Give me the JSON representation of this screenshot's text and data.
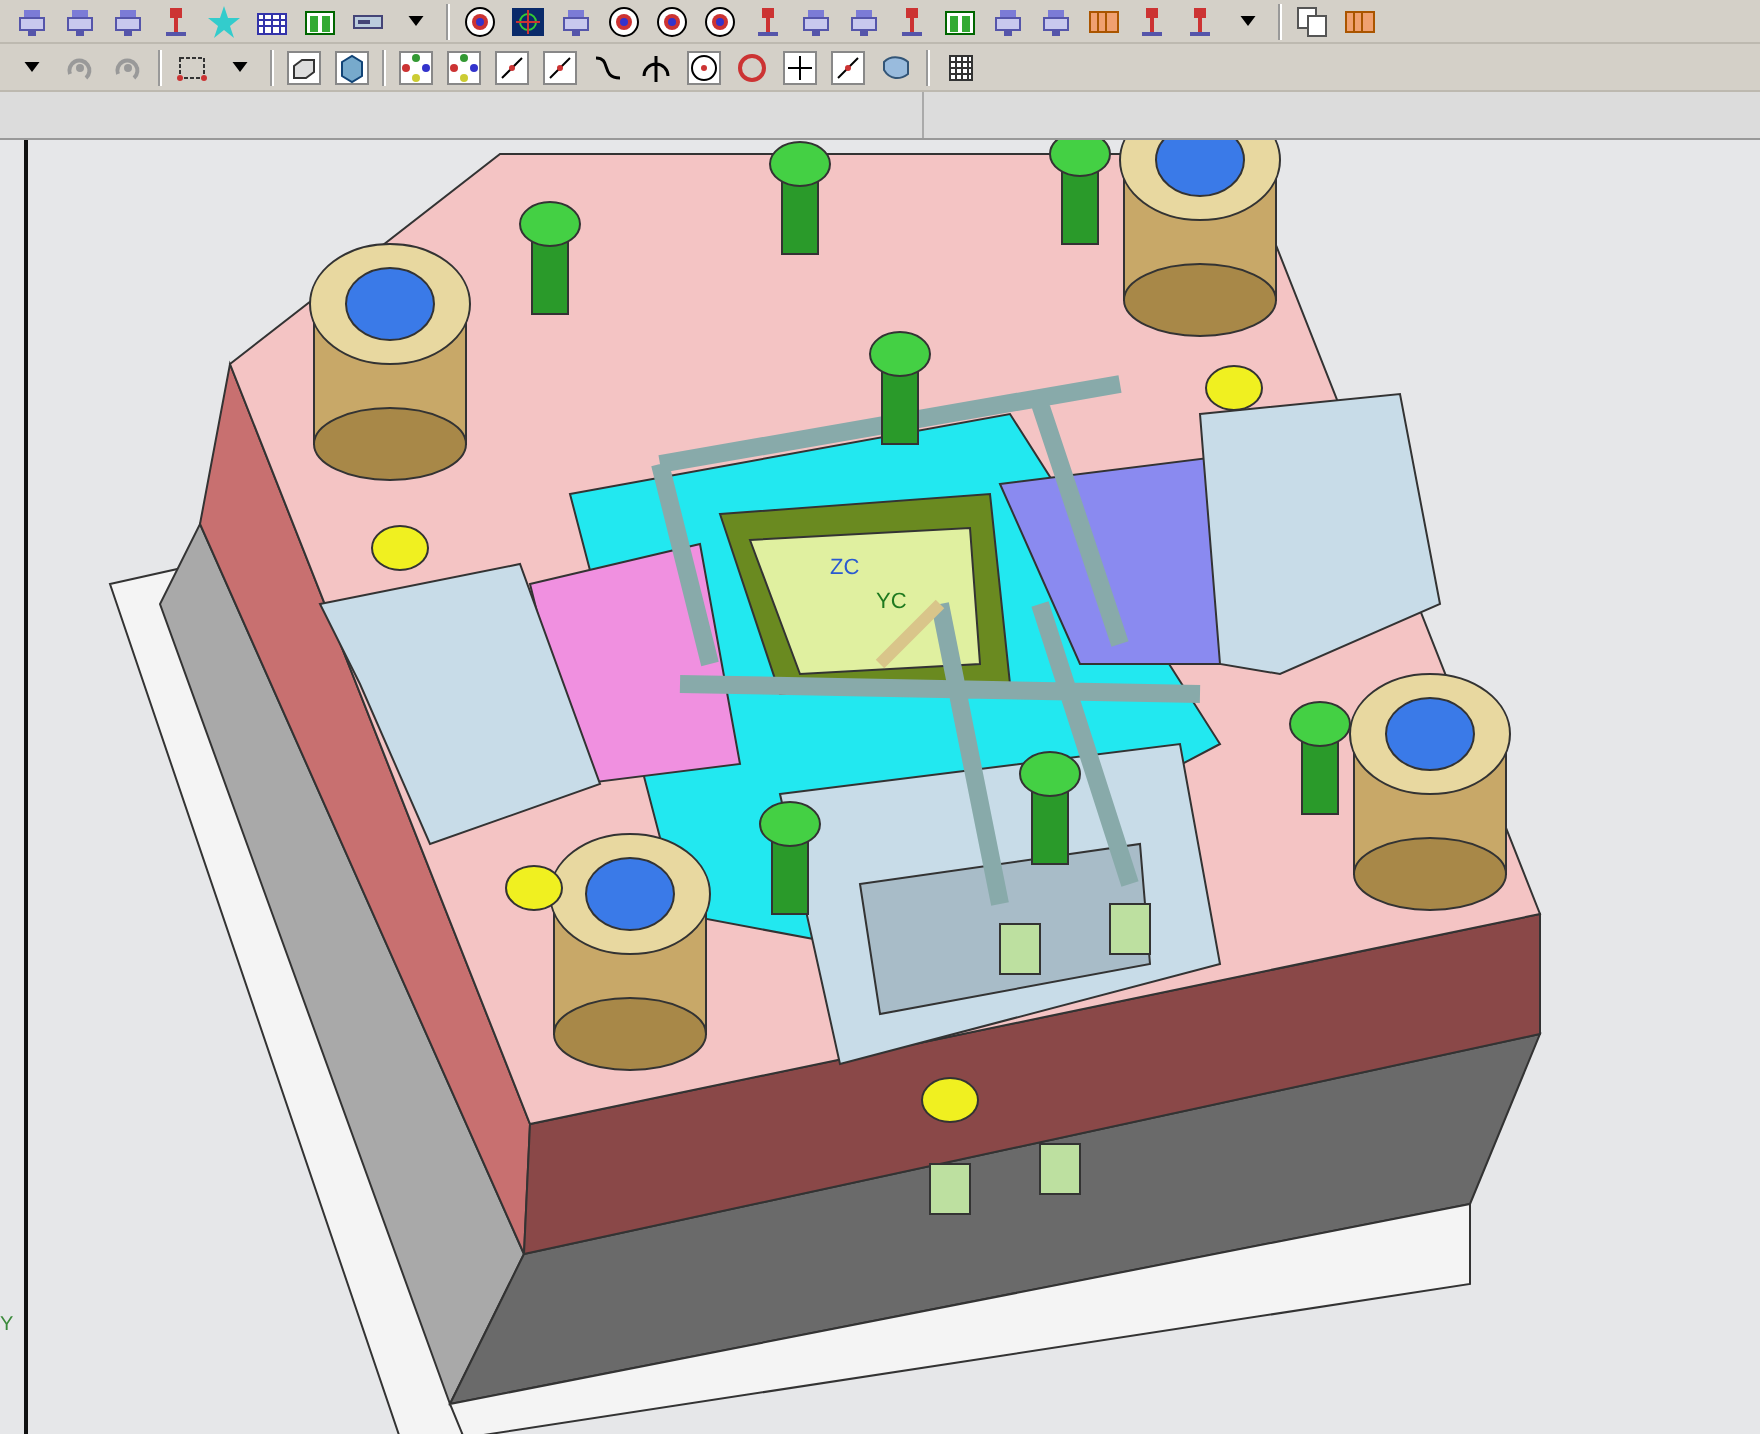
{
  "toolbars": [
    {
      "buttons": [
        {
          "kind": "part"
        },
        {
          "kind": "part"
        },
        {
          "kind": "part"
        },
        {
          "kind": "pin"
        },
        {
          "kind": "star"
        },
        {
          "kind": "grid"
        },
        {
          "kind": "table"
        },
        {
          "kind": "tool"
        },
        {
          "kind": "more"
        },
        {
          "kind": "sep"
        },
        {
          "kind": "disc"
        },
        {
          "kind": "target"
        },
        {
          "kind": "part"
        },
        {
          "kind": "disc"
        },
        {
          "kind": "disc"
        },
        {
          "kind": "disc"
        },
        {
          "kind": "pin"
        },
        {
          "kind": "part"
        },
        {
          "kind": "part"
        },
        {
          "kind": "pin"
        },
        {
          "kind": "table"
        },
        {
          "kind": "part"
        },
        {
          "kind": "part"
        },
        {
          "kind": "block"
        },
        {
          "kind": "pin"
        },
        {
          "kind": "pin"
        },
        {
          "kind": "more"
        },
        {
          "kind": "sep"
        },
        {
          "kind": "copy"
        },
        {
          "kind": "block"
        }
      ]
    },
    {
      "buttons": [
        {
          "kind": "more"
        },
        {
          "kind": "rotate"
        },
        {
          "kind": "rotate"
        },
        {
          "kind": "sep"
        },
        {
          "kind": "select"
        },
        {
          "kind": "more"
        },
        {
          "kind": "sep"
        },
        {
          "kind": "box"
        },
        {
          "kind": "cube"
        },
        {
          "kind": "sep"
        },
        {
          "kind": "points"
        },
        {
          "kind": "points"
        },
        {
          "kind": "line"
        },
        {
          "kind": "line"
        },
        {
          "kind": "curve"
        },
        {
          "kind": "tangent"
        },
        {
          "kind": "circlept"
        },
        {
          "kind": "circle"
        },
        {
          "kind": "cross"
        },
        {
          "kind": "line"
        },
        {
          "kind": "surface"
        },
        {
          "kind": "sep"
        },
        {
          "kind": "mesh"
        }
      ]
    }
  ],
  "viewport": {
    "axis_labels": [
      {
        "text": "ZC",
        "kind": "z"
      },
      {
        "text": "YC",
        "kind": "y"
      }
    ],
    "corner_axis": "Y"
  }
}
